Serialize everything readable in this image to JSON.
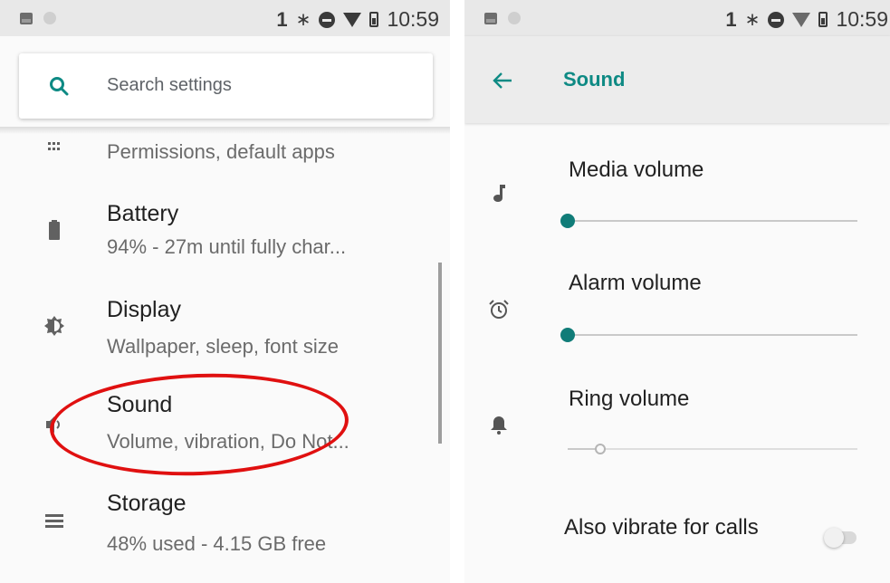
{
  "colors": {
    "accent": "#0e8a84",
    "highlight": "#e01010"
  },
  "status_bar": {
    "sim": "1",
    "time": "10:59"
  },
  "settings_list": {
    "search": {
      "placeholder": "Search settings"
    },
    "partial_item": {
      "summary": "Permissions, default apps",
      "icon": "apps-grid-icon"
    },
    "items": [
      {
        "title": "Battery",
        "summary": "94% - 27m until fully char...",
        "icon": "battery-icon"
      },
      {
        "title": "Display",
        "summary": "Wallpaper, sleep, font size",
        "icon": "brightness-icon"
      },
      {
        "title": "Sound",
        "summary": "Volume, vibration, Do Not...",
        "icon": "volume-icon"
      },
      {
        "title": "Storage",
        "summary": "48% used - 4.15 GB free",
        "icon": "storage-icon"
      }
    ]
  },
  "sound_screen": {
    "title": "Sound",
    "sliders": [
      {
        "label": "Media volume",
        "icon": "music-note-icon",
        "level": 0.0,
        "enabled": true
      },
      {
        "label": "Alarm volume",
        "icon": "alarm-clock-icon",
        "level": 0.0,
        "enabled": true
      },
      {
        "label": "Ring volume",
        "icon": "bell-icon",
        "level": 0.12,
        "enabled": false
      }
    ],
    "vibrate": {
      "label": "Also vibrate for calls",
      "on": false
    }
  }
}
